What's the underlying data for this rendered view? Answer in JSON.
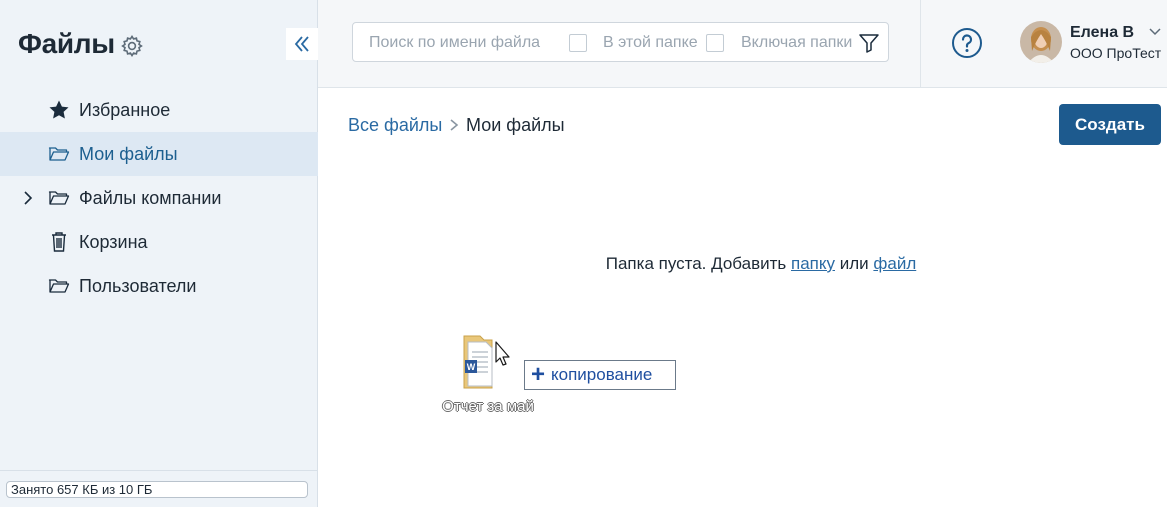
{
  "app": {
    "title": "Файлы"
  },
  "sidebar": {
    "items": [
      {
        "label": "Избранное",
        "icon": "star-icon"
      },
      {
        "label": "Мои файлы",
        "icon": "folder-icon",
        "active": true
      },
      {
        "label": "Файлы компании",
        "icon": "folder-icon",
        "expandable": true
      },
      {
        "label": "Корзина",
        "icon": "trash-icon"
      },
      {
        "label": "Пользователи",
        "icon": "folder-icon"
      }
    ],
    "storage_text": "Занято 657 КБ из 10 ГБ"
  },
  "header": {
    "search_placeholder": "Поиск по имени файла",
    "filter_in_folder": "В этой папке",
    "filter_include_folders": "Включая папки",
    "user_name": "Елена В",
    "user_org": "ООО ПроТест"
  },
  "main": {
    "breadcrumb_root": "Все файлы",
    "breadcrumb_current": "Мои файлы",
    "create_label": "Создать",
    "empty_prefix": "Папка пуста. Добавить",
    "empty_link_folder": "папку",
    "empty_or": "или",
    "empty_link_file": "файл",
    "drag_file_name": "Отчет за май",
    "drag_tooltip": "копирование"
  },
  "colors": {
    "accent": "#1d5a8e",
    "link": "#2a6aa3",
    "sidebar_bg": "#eef3f8",
    "sidebar_active_bg": "#dde8f3"
  }
}
